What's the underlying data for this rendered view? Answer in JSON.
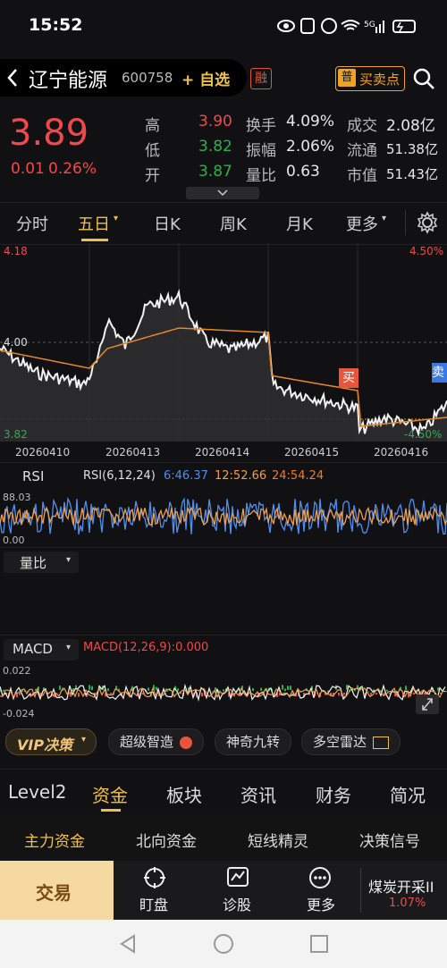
{
  "status": {
    "time": "15:52",
    "network": "5G"
  },
  "header": {
    "title": "辽宁能源",
    "code": "600758",
    "watchlist": "+ 自选",
    "margin_badge": "融",
    "trade_point_badge": "普",
    "trade_point_label": "买卖点"
  },
  "quote": {
    "price": "3.89",
    "change": "0.01",
    "change_pct": "0.26%",
    "stats": [
      {
        "k1": "高",
        "v1": "3.90",
        "k2": "换手",
        "v2": "4.09%",
        "k3": "成交",
        "v3": "2.08亿"
      },
      {
        "k1": "低",
        "v1": "3.82",
        "k2": "振幅",
        "v2": "2.06%",
        "k3": "流通",
        "v3": "51.38亿"
      },
      {
        "k1": "开",
        "v1": "3.87",
        "k2": "量比",
        "v2": "0.63",
        "k3": "市值",
        "v3": "51.43亿"
      }
    ]
  },
  "tabs": [
    "分时",
    "五日",
    "日K",
    "周K",
    "月K",
    "更多"
  ],
  "active_tab": "五日",
  "chart": {
    "y_top": "4.18",
    "y_mid": "4.00",
    "y_bottom": "3.82",
    "pct_top": "4.50%",
    "pct_bottom": "-4.50%",
    "dates": [
      "20260410",
      "20260413",
      "20260414",
      "20260415",
      "20260416"
    ],
    "buy_label": "买",
    "sell_label": "卖"
  },
  "rsi": {
    "label": "RSI",
    "params": "RSI(6,12,24)",
    "r6": "6:46.37",
    "r12": "12:52.66",
    "r24": "24:54.24",
    "top": "88.03",
    "bottom": "0.00"
  },
  "volume": {
    "label": "量比"
  },
  "macd": {
    "label": "MACD",
    "params": "MACD(12,26,9):0.000",
    "top": "0.022",
    "bottom": "-0.024"
  },
  "toolbar2": {
    "vip": "VIP决策",
    "chips": [
      "超级智造",
      "神奇九转",
      "多空雷达"
    ]
  },
  "subtabs1": [
    "Level2",
    "资金",
    "板块",
    "资讯",
    "财务",
    "简况"
  ],
  "subtabs1_active": "资金",
  "subtabs2": [
    "主力资金",
    "北向资金",
    "短线精灵",
    "决策信号"
  ],
  "subtabs2_active": "主力资金",
  "bottom": {
    "trade": "交易",
    "items": [
      "盯盘",
      "诊股",
      "更多"
    ],
    "ticker_name": "煤炭开采II",
    "ticker_pct": "1.07%"
  },
  "colors": {
    "up": "#f0494c",
    "down": "#28b24b",
    "accent": "#f0b94a",
    "rsi6": "#4f8ff0",
    "rsi12": "#f0a04a",
    "rsi24": "#f07a2a"
  }
}
